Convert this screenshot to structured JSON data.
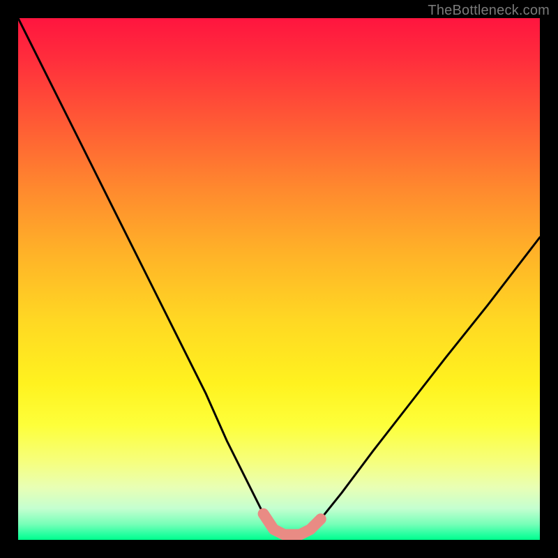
{
  "watermark": "TheBottleneck.com",
  "chart_data": {
    "type": "line",
    "title": "",
    "xlabel": "",
    "ylabel": "",
    "xlim": [
      0,
      100
    ],
    "ylim": [
      0,
      100
    ],
    "series": [
      {
        "name": "bottleneck-curve",
        "x": [
          0,
          6,
          12,
          18,
          24,
          30,
          36,
          40,
          44,
          47,
          49,
          51,
          54,
          56,
          58,
          62,
          68,
          75,
          82,
          90,
          100
        ],
        "y": [
          100,
          88,
          76,
          64,
          52,
          40,
          28,
          19,
          11,
          5,
          2,
          1,
          1,
          2,
          4,
          9,
          17,
          26,
          35,
          45,
          58
        ]
      }
    ],
    "highlight": {
      "name": "optimal-range",
      "x": [
        47,
        49,
        51,
        54,
        56,
        58
      ],
      "y": [
        5,
        2,
        1,
        1,
        2,
        4
      ]
    },
    "gradient_stops": [
      {
        "pos": 0.0,
        "color": "#ff153f"
      },
      {
        "pos": 0.5,
        "color": "#ffc825"
      },
      {
        "pos": 0.8,
        "color": "#fdff4a"
      },
      {
        "pos": 1.0,
        "color": "#00ff8c"
      }
    ]
  }
}
